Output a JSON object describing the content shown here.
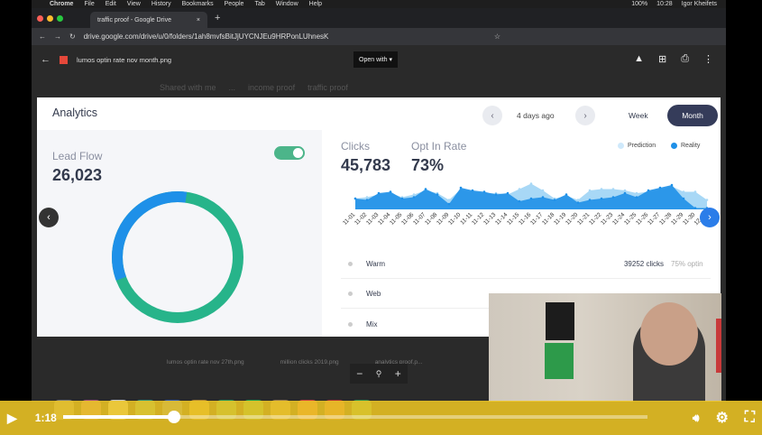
{
  "menubar": {
    "app": "Chrome",
    "items": [
      "File",
      "Edit",
      "View",
      "History",
      "Bookmarks",
      "People",
      "Tab",
      "Window",
      "Help"
    ],
    "battery": "100%",
    "time": "10:28",
    "user": "Igor Kheifets"
  },
  "browser": {
    "tab_title": "traffic proof - Google Drive",
    "url": "drive.google.com/drive/u/0/folders/1ah8mvfsBitJjUYCNJEu9HRPonLUhnesK"
  },
  "viewer": {
    "file_name": "lumos optin rate nov month.png",
    "open_with": "Open with",
    "breadcrumbs": [
      "Shared with me",
      "...",
      "income proof",
      "traffic proof"
    ],
    "files": [
      "lumos optin rate nov 27th.png",
      "million clicks 2019.png",
      "analytics proof.p..."
    ]
  },
  "analytics": {
    "title": "Analytics",
    "period": "4 days ago",
    "week": "Week",
    "month": "Month",
    "lead_flow": {
      "label": "Lead Flow",
      "value": "26,023",
      "toggle_on": true,
      "donut": {
        "colors": [
          "#1e90e8",
          "#27b48a"
        ],
        "blue_fraction": 0.33
      }
    },
    "clicks": {
      "label": "Clicks",
      "value": "45,783"
    },
    "optin": {
      "label": "Opt In Rate",
      "value": "73%"
    },
    "legend": {
      "prediction": "Prediction",
      "reality": "Reality",
      "prediction_color": "#a8d8f6",
      "reality_color": "#1e90e8"
    },
    "rows": [
      {
        "name": "Warm",
        "clicks": "39252 clicks",
        "optin": "75% optin"
      },
      {
        "name": "Web",
        "clicks": "",
        "optin": ""
      },
      {
        "name": "Mix",
        "clicks": "",
        "optin": ""
      }
    ]
  },
  "chart_data": {
    "type": "area",
    "x": [
      "11-01",
      "11-02",
      "11-03",
      "11-04",
      "11-05",
      "11-06",
      "11-07",
      "11-08",
      "11-09",
      "11-10",
      "11-11",
      "11-12",
      "11-13",
      "11-14",
      "11-15",
      "11-16",
      "11-17",
      "11-18",
      "11-19",
      "11-20",
      "11-21",
      "11-22",
      "11-23",
      "11-24",
      "11-25",
      "11-26",
      "11-27",
      "11-28",
      "11-29",
      "11-30",
      "12-01"
    ],
    "series": [
      {
        "name": "Prediction",
        "values": [
          40,
          45,
          55,
          60,
          45,
          55,
          70,
          60,
          35,
          75,
          65,
          60,
          60,
          55,
          75,
          95,
          70,
          40,
          50,
          35,
          70,
          75,
          75,
          70,
          60,
          65,
          75,
          85,
          65,
          65,
          35
        ]
      },
      {
        "name": "Reality",
        "values": [
          40,
          35,
          60,
          65,
          40,
          45,
          75,
          55,
          20,
          80,
          70,
          65,
          55,
          60,
          30,
          40,
          45,
          35,
          55,
          25,
          35,
          40,
          45,
          60,
          45,
          70,
          80,
          90,
          40,
          5,
          5
        ]
      }
    ],
    "legend": "top-right",
    "grid": false
  },
  "player": {
    "time": "1:18",
    "progress": 0.19
  }
}
